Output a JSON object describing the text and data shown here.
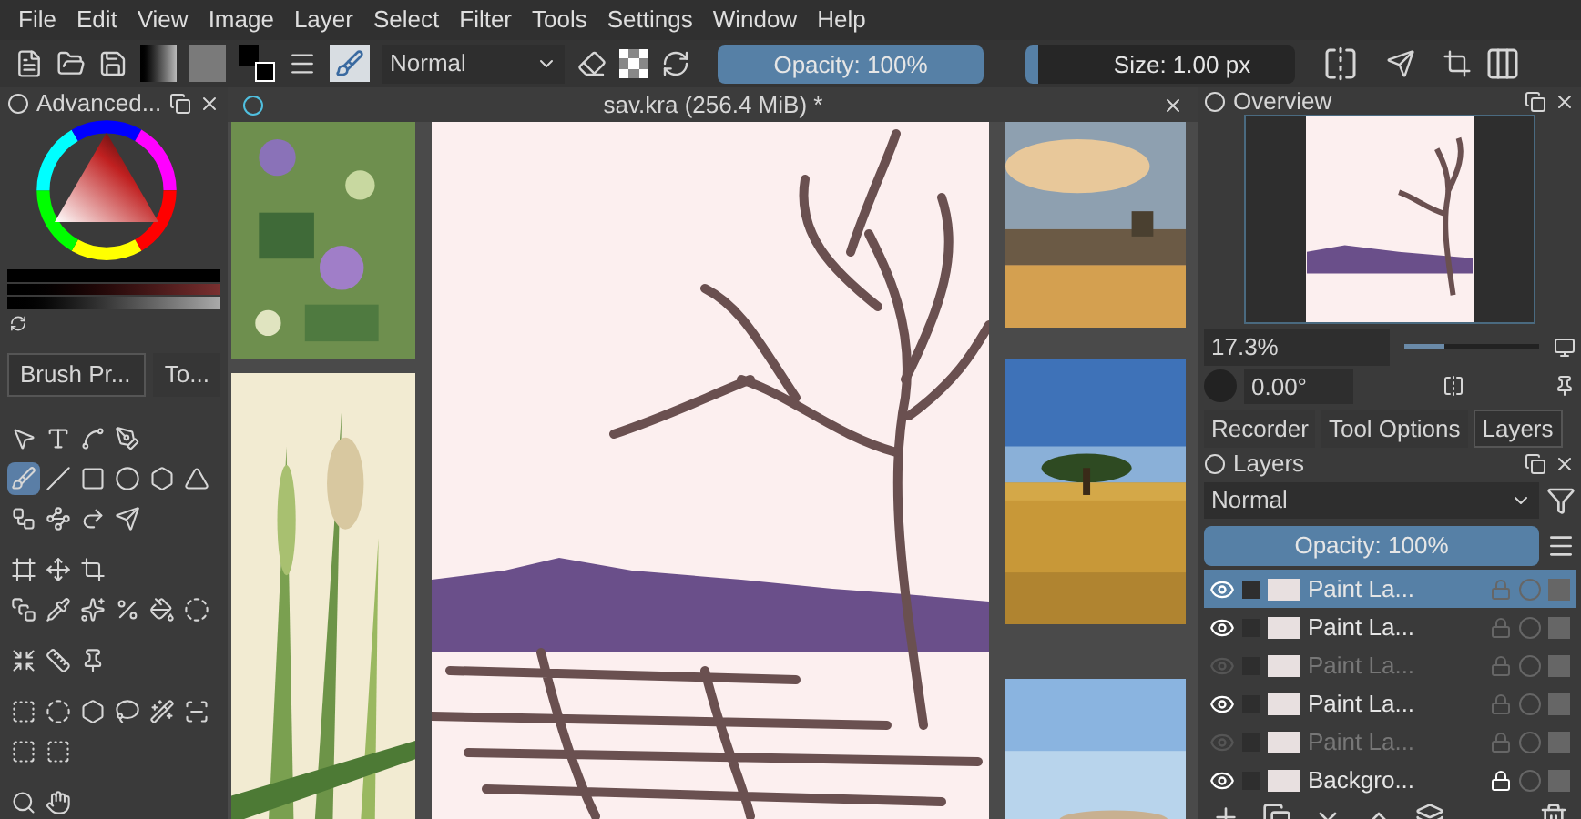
{
  "menu": [
    "File",
    "Edit",
    "View",
    "Image",
    "Layer",
    "Select",
    "Filter",
    "Tools",
    "Settings",
    "Window",
    "Help"
  ],
  "toolbar": {
    "blend_mode": "Normal",
    "opacity": {
      "label": "Opacity: 100%",
      "level": 1
    },
    "size": {
      "label": "Size: 1.00 px",
      "level": 0.05
    }
  },
  "color_docker": {
    "title": "Advanced..."
  },
  "left_tabs": [
    {
      "label": "Brush Pr...",
      "selected": true
    },
    {
      "label": "To...",
      "selected": false
    }
  ],
  "tool_groups": [
    [
      {
        "selected": false
      },
      {
        "selected": false
      },
      {
        "selected": false
      },
      {
        "selected": false
      }
    ],
    [
      {
        "selected": true
      },
      {
        "selected": false
      },
      {
        "selected": false
      },
      {
        "selected": false
      },
      {
        "selected": false
      },
      {
        "selected": false
      }
    ],
    [
      {
        "selected": false
      },
      {
        "selected": false
      },
      {
        "selected": false
      },
      {
        "selected": false
      }
    ],
    [
      {
        "selected": false
      },
      {
        "selected": false
      },
      {
        "selected": false
      }
    ],
    [
      {
        "selected": false
      },
      {
        "selected": false
      },
      {
        "selected": false
      },
      {
        "selected": false
      },
      {
        "selected": false
      },
      {
        "selected": false
      }
    ],
    [
      {
        "selected": false
      },
      {
        "selected": false
      },
      {
        "selected": false
      }
    ],
    [
      {
        "selected": false
      },
      {
        "selected": false
      },
      {
        "selected": false
      },
      {
        "selected": false
      },
      {
        "selected": false
      },
      {
        "selected": false
      }
    ],
    [
      {
        "selected": false
      },
      {
        "selected": false
      }
    ],
    [
      {
        "selected": false
      },
      {
        "selected": false
      }
    ]
  ],
  "document": {
    "title": "sav.kra (256.4 MiB) *"
  },
  "references_left": [
    {
      "kind": "picture"
    },
    {
      "kind": "picture"
    }
  ],
  "references_right": [
    {
      "kind": "picture"
    },
    {
      "kind": "picture"
    },
    {
      "kind": "picture"
    }
  ],
  "overview": {
    "title": "Overview",
    "zoom": "17.3%",
    "zoom_slider": {
      "level": 0.3
    },
    "rotation": "0.00°"
  },
  "right_tabs": [
    {
      "label": "Recorder",
      "selected": false
    },
    {
      "label": "Tool Options",
      "selected": false
    },
    {
      "label": "Layers",
      "selected": true
    }
  ],
  "layers": {
    "title": "Layers",
    "blend_mode": "Normal",
    "opacity": {
      "label": "Opacity:  100%",
      "level": 1
    },
    "items": [
      {
        "name": "Paint La...",
        "visible": true,
        "selected": true,
        "locked": false
      },
      {
        "name": "Paint La...",
        "visible": true,
        "selected": false,
        "locked": false
      },
      {
        "name": "Paint La...",
        "visible": false,
        "selected": false,
        "locked": false
      },
      {
        "name": "Paint La...",
        "visible": true,
        "selected": false,
        "locked": false
      },
      {
        "name": "Paint La...",
        "visible": false,
        "selected": false,
        "locked": false
      },
      {
        "name": "Backgro...",
        "visible": true,
        "selected": false,
        "locked": true
      }
    ]
  }
}
